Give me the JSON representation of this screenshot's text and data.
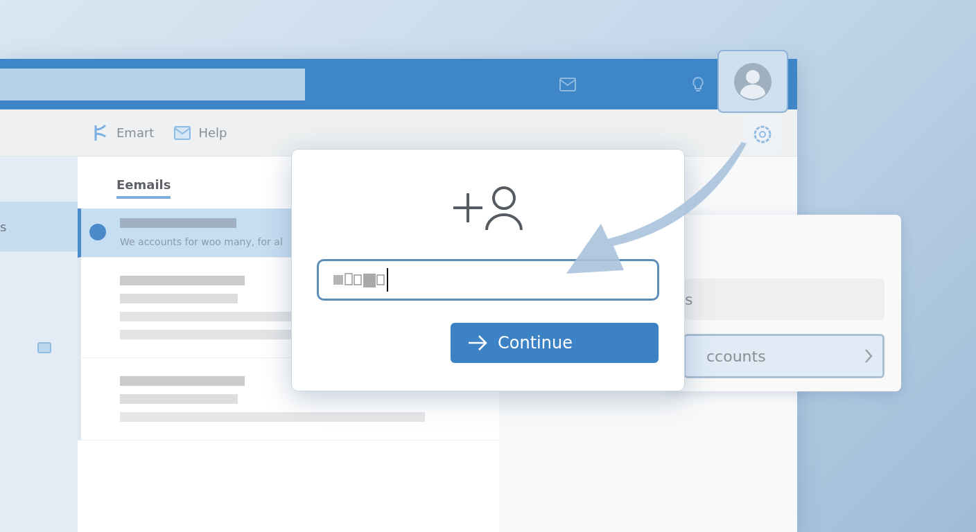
{
  "sidebar": {
    "items": [
      {
        "label": "s",
        "selected": true
      }
    ]
  },
  "toolbar": {
    "items": [
      {
        "label": "Emart",
        "kind": "branch"
      },
      {
        "label": "Help",
        "kind": "mail"
      }
    ]
  },
  "email_list": {
    "heading": "Eemails",
    "rows": [
      {
        "selected": true,
        "preview": "We accounts for woo many, for al"
      },
      {
        "selected": false
      },
      {
        "selected": false
      }
    ]
  },
  "flyout": {
    "items": [
      {
        "label": "s",
        "kind": "plain"
      },
      {
        "label": "ccounts",
        "kind": "nav"
      }
    ]
  },
  "dialog": {
    "button": "Continue"
  }
}
